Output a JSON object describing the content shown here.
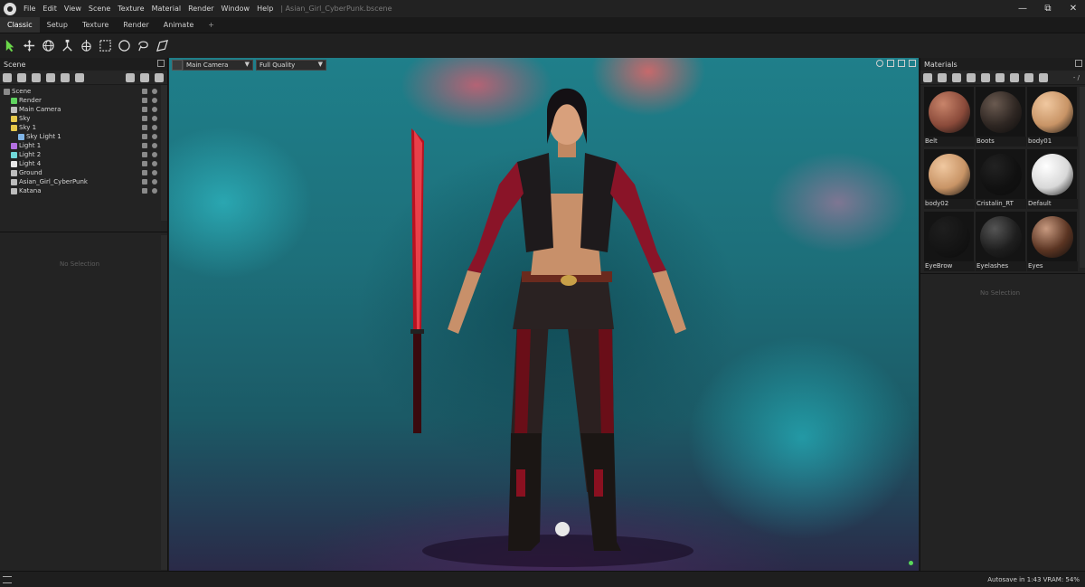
{
  "menubar": {
    "items": [
      "File",
      "Edit",
      "View",
      "Scene",
      "Texture",
      "Material",
      "Render",
      "Window",
      "Help"
    ],
    "document_title": "|  Asian_Girl_CyberPunk.bscene",
    "window_controls": {
      "minimize": "—",
      "restore": "⧉",
      "close": "✕"
    }
  },
  "tabs": [
    {
      "label": "Classic",
      "active": true
    },
    {
      "label": "Setup",
      "active": false
    },
    {
      "label": "Texture",
      "active": false
    },
    {
      "label": "Render",
      "active": false
    },
    {
      "label": "Animate",
      "active": false
    },
    {
      "label": "+",
      "active": false
    }
  ],
  "toolbar": {
    "tools": [
      "select-icon",
      "move-icon",
      "rotate-icon",
      "scale-icon",
      "transform-icon",
      "box-select-icon",
      "circle-select-icon",
      "lasso-icon",
      "freehand-select-icon"
    ]
  },
  "scene_panel": {
    "title": "Scene",
    "tree": [
      {
        "label": "Scene",
        "depth": 0,
        "icon_color": "#8a8a8a"
      },
      {
        "label": "Render",
        "depth": 1,
        "icon_color": "#5fd35f"
      },
      {
        "label": "Main Camera",
        "depth": 1,
        "icon_color": "#bdbdbd"
      },
      {
        "label": "Sky",
        "depth": 1,
        "icon_color": "#e6c84a"
      },
      {
        "label": "Sky 1",
        "depth": 1,
        "icon_color": "#e6c84a"
      },
      {
        "label": "Sky Light 1",
        "depth": 2,
        "icon_color": "#7fb4e6"
      },
      {
        "label": "Light 1",
        "depth": 1,
        "icon_color": "#b36fe0"
      },
      {
        "label": "Light 2",
        "depth": 1,
        "icon_color": "#6fd8d8"
      },
      {
        "label": "Light 4",
        "depth": 1,
        "icon_color": "#e8e8e8"
      },
      {
        "label": "Ground",
        "depth": 1,
        "icon_color": "#bdbdbd"
      },
      {
        "label": "Asian_Girl_CyberPunk",
        "depth": 1,
        "icon_color": "#bdbdbd"
      },
      {
        "label": "Katana",
        "depth": 1,
        "icon_color": "#bdbdbd"
      }
    ],
    "no_selection": "No Selection"
  },
  "viewport": {
    "camera": "Main Camera",
    "quality": "Full Quality"
  },
  "materials_panel": {
    "title": "Materials",
    "search_value": "- /",
    "items": [
      {
        "label": "Belt",
        "color": "#8a4a3a",
        "highlight": "#c8846a"
      },
      {
        "label": "Boots",
        "color": "#2e2622",
        "highlight": "#6a5a50"
      },
      {
        "label": "body01",
        "color": "#c89466",
        "highlight": "#f0c8a0"
      },
      {
        "label": "body02",
        "color": "#c89466",
        "highlight": "#f0c8a0"
      },
      {
        "label": "Cristalin_RT",
        "color": "#111111",
        "highlight": "#222222"
      },
      {
        "label": "Default",
        "color": "#d8d8d8",
        "highlight": "#ffffff"
      },
      {
        "label": "EyeBrow",
        "color": "#141414",
        "highlight": "#1e1e1e"
      },
      {
        "label": "Eyelashes",
        "color": "#1e1e1e",
        "highlight": "#555555"
      },
      {
        "label": "Eyes",
        "color": "#5a3422",
        "highlight": "#c89a80"
      }
    ],
    "no_selection": "No Selection"
  },
  "statusbar": {
    "text": "Autosave in 1:43   VRAM: 54%"
  }
}
